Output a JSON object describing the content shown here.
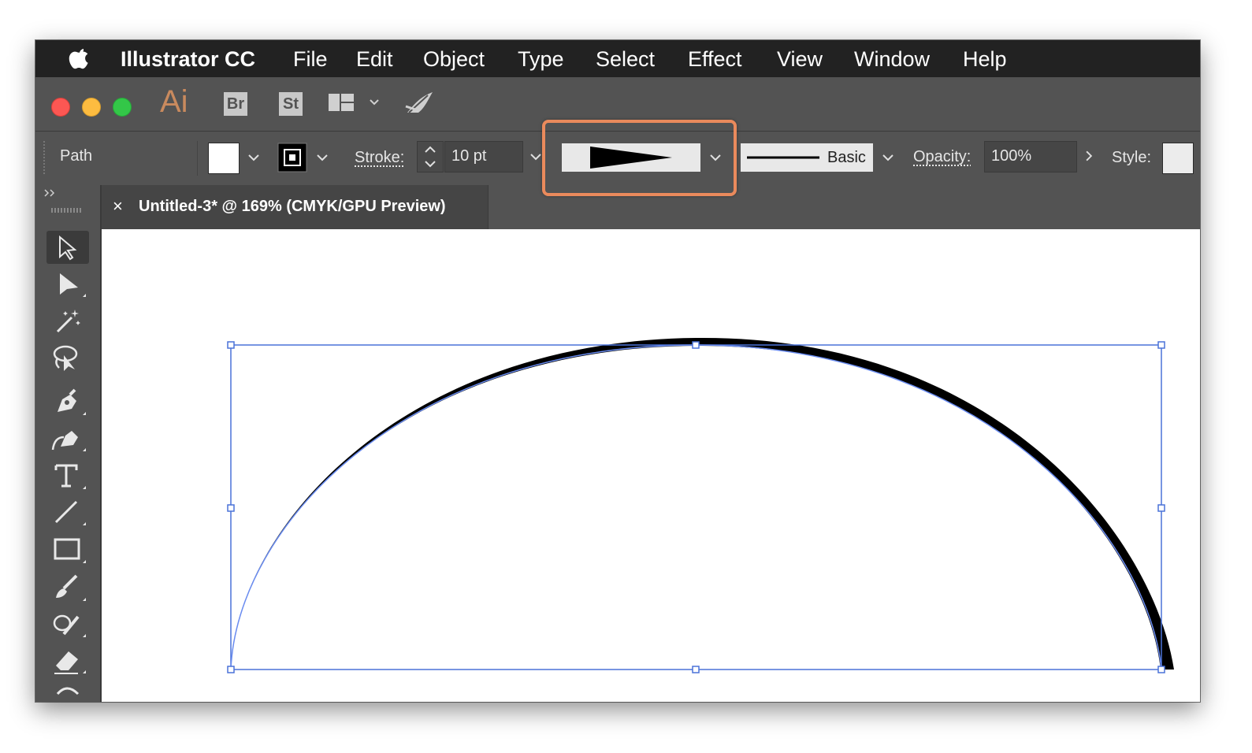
{
  "menubar": {
    "app_name": "Illustrator CC",
    "items": [
      "File",
      "Edit",
      "Object",
      "Type",
      "Select",
      "Effect",
      "View",
      "Window",
      "Help"
    ]
  },
  "appbar": {
    "logo": "Ai",
    "bridge_label": "Br",
    "stock_label": "St",
    "traffic_colors": [
      "#fc5753",
      "#fdbc40",
      "#33c748"
    ]
  },
  "control": {
    "selection_type": "Path",
    "stroke_label": "Stroke:",
    "stroke_value": "10 pt",
    "profile_label": "Basic",
    "opacity_label": "Opacity:",
    "opacity_value": "100%",
    "style_label": "Style:"
  },
  "document": {
    "tab_title": "Untitled-3* @ 169% (CMYK/GPU Preview)",
    "close_glyph": "×"
  },
  "accent": {
    "highlight": "#ea8a5c",
    "selection": "#4a72d8"
  }
}
